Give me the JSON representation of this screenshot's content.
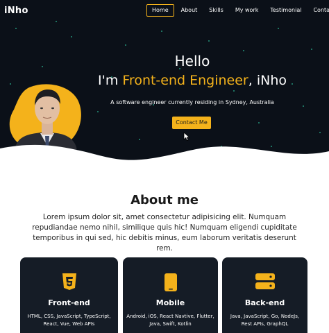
{
  "brand": {
    "logo": "iNho",
    "accent_color": "#f4b21b",
    "hero_bg": "#0b1018"
  },
  "nav": {
    "items": [
      {
        "label": "Home",
        "active": true
      },
      {
        "label": "About",
        "active": false
      },
      {
        "label": "Skills",
        "active": false
      },
      {
        "label": "My work",
        "active": false
      },
      {
        "label": "Testimonial",
        "active": false
      },
      {
        "label": "Contact",
        "active": false
      }
    ]
  },
  "hero": {
    "greeting": "Hello",
    "intro_prefix": "I'm ",
    "role": "Front-end Engineer",
    "intro_suffix": ", iNho",
    "tagline": "A software engineer currently residing in Sydney, Australia",
    "cta_label": "Contact Me"
  },
  "about": {
    "title": "About me",
    "text": "Lorem ipsum dolor sit, amet consectetur adipisicing elit. Numquam repudiandae nemo nihil, similique quis hic! Numquam eligendi cupiditate temporibus in qui sed, hic debitis minus, eum laborum veritatis deserunt rem."
  },
  "skills": [
    {
      "icon": "html5-icon",
      "title": "Front-end",
      "desc": "HTML, CSS, JavaScript, TypeScript, React, Vue, Web APIs"
    },
    {
      "icon": "mobile-phone-icon",
      "title": "Mobile",
      "desc": "Android, iOS, React Navtive, Flutter, Java, Swift, Kotlin"
    },
    {
      "icon": "server-icon",
      "title": "Back-end",
      "desc": "Java, JavaScript, Go, NodeJs, Rest APIs, GraphQL"
    }
  ]
}
